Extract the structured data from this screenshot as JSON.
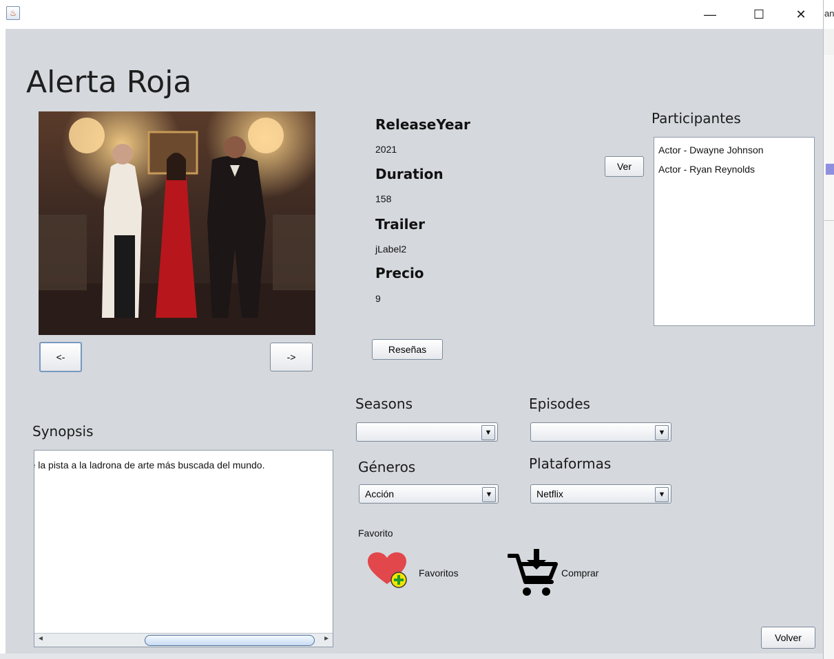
{
  "window": {
    "controls": {
      "minimize": "—",
      "maximize": "☐",
      "close": "✕"
    },
    "right_edge_text": "an"
  },
  "movie": {
    "title": "Alerta Roja",
    "release_year_label": "ReleaseYear",
    "release_year": "2021",
    "duration_label": "Duration",
    "duration": "158",
    "trailer_label": "Trailer",
    "trailer": "jLabel2",
    "price_label": "Precio",
    "price": "9"
  },
  "buttons": {
    "prev": "<-",
    "next": "->",
    "ver": "Ver",
    "resenas": "Reseñas",
    "volver": "Volver"
  },
  "participants": {
    "label": "Participantes",
    "items": [
      "Actor - Dwayne Johnson",
      "Actor - Ryan Reynolds"
    ]
  },
  "synopsis": {
    "label": "Synopsis",
    "text": "gue la pista a la ladrona de arte más buscada del mundo."
  },
  "selectors": {
    "seasons_label": "Seasons",
    "seasons_value": "",
    "episodes_label": "Episodes",
    "episodes_value": "",
    "generos_label": "Géneros",
    "generos_value": "Acción",
    "plataformas_label": "Plataformas",
    "plataformas_value": "Netflix"
  },
  "favorito": {
    "label": "Favorito",
    "favoritos_label": "Favoritos",
    "comprar_label": "Comprar"
  },
  "colors": {
    "background": "#d5d8dd",
    "heart": "#e2474b",
    "plus_badge": "#f2e400"
  }
}
